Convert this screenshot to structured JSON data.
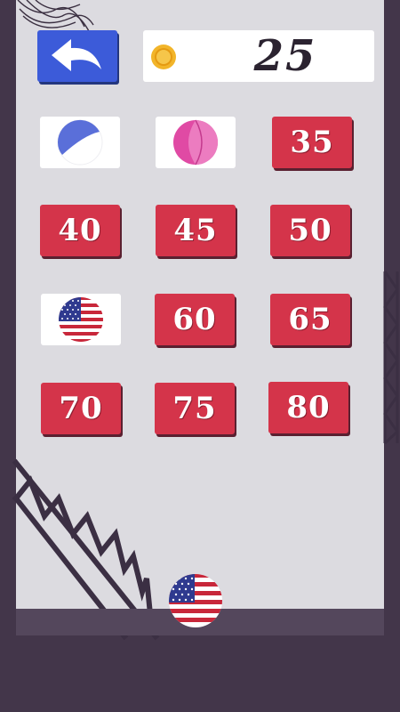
{
  "header": {
    "back_button": {
      "icon": "back-arrow-icon"
    },
    "coins": {
      "icon": "gold-coin-icon",
      "count": "25"
    }
  },
  "grid": {
    "items": [
      {
        "type": "ball",
        "skin": "blue-half-ball",
        "price": ""
      },
      {
        "type": "ball",
        "skin": "pink-ball",
        "price": ""
      },
      {
        "type": "price",
        "price": "35"
      },
      {
        "type": "price",
        "price": "40"
      },
      {
        "type": "price",
        "price": "45"
      },
      {
        "type": "price",
        "price": "50"
      },
      {
        "type": "ball",
        "skin": "usa-flag-ball",
        "price": ""
      },
      {
        "type": "price",
        "price": "60"
      },
      {
        "type": "price",
        "price": "65"
      },
      {
        "type": "price",
        "price": "70"
      },
      {
        "type": "price",
        "price": "75"
      },
      {
        "type": "price",
        "price": "80"
      }
    ]
  },
  "player_ball": {
    "skin": "usa-flag-ball"
  },
  "colors": {
    "background": "#43364a",
    "frame": "#dcdbe0",
    "locked_tile": "#d4344a",
    "back_button": "#3c5bd9",
    "coin": "#f2b52a"
  }
}
